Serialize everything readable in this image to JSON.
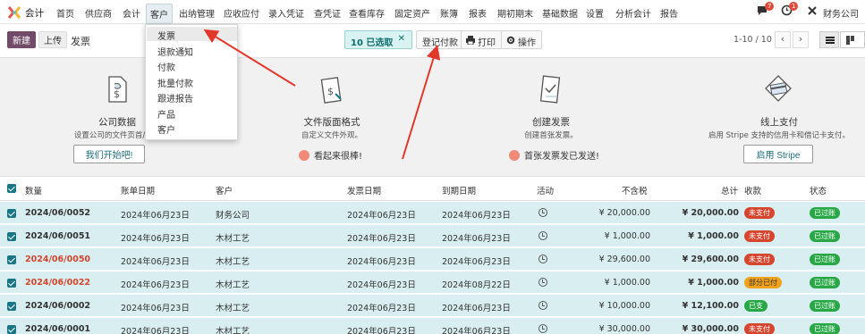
{
  "topnav": {
    "app_name": "会计",
    "items": [
      "首页",
      "供应商",
      "会计",
      "客户",
      "出纳管理",
      "应收应付",
      "录入凭证",
      "查凭证",
      "查看库存",
      "固定资产",
      "账簿",
      "报表",
      "期初期末",
      "基础数据",
      "设置",
      "分析会计",
      "报告"
    ],
    "chat_count": "7",
    "activity_count": "1",
    "company": "财务公司"
  },
  "dropdown": {
    "items": [
      "发票",
      "退款通知",
      "付款",
      "批量付款",
      "跟进报告",
      "产品",
      "客户"
    ]
  },
  "control": {
    "new_label": "新建",
    "upload_label": "上传",
    "title": "发票",
    "selected_label": "10 已选取",
    "register_payment_label": "登记付款",
    "print_label": "打印",
    "action_label": "操作",
    "pager": "1-10 / 10"
  },
  "onboarding": {
    "steps": [
      {
        "title": "公司数据",
        "desc": "设置公司的文件页首/页尾",
        "button": "我们开始吧!"
      },
      {
        "title": "文件版面格式",
        "desc": "自定义文件外观。",
        "done": "看起来很棒!"
      },
      {
        "title": "创建发票",
        "desc": "创建首张发票。",
        "done": "首张发票发已发送!"
      },
      {
        "title": "线上支付",
        "desc": "启用 Stripe 支持的信用卡和借记卡支付。",
        "button": "启用 Stripe"
      }
    ]
  },
  "table": {
    "headers": {
      "number": "数量",
      "bill_date": "账单日期",
      "customer": "客户",
      "invoice_date": "发票日期",
      "due_date": "到期日期",
      "activity": "活动",
      "untaxed": "不含税",
      "total": "总计",
      "payment": "收款",
      "status": "状态"
    },
    "rows": [
      {
        "number": "2024/06/0052",
        "bill_date": "2024年06月23日",
        "customer": "财务公司",
        "invoice_date": "2024年06月23日",
        "due_date": "2024年06月23日",
        "untaxed": "¥ 20,000.00",
        "total": "¥ 20,000.00",
        "payment": "未支付",
        "payment_kind": "red",
        "status": "已过账",
        "red_number": false
      },
      {
        "number": "2024/06/0051",
        "bill_date": "2024年06月23日",
        "customer": "木材工艺",
        "invoice_date": "2024年06月23日",
        "due_date": "2024年06月23日",
        "untaxed": "¥ 1,000.00",
        "total": "¥ 1,000.00",
        "payment": "未支付",
        "payment_kind": "red",
        "status": "已过账",
        "red_number": false
      },
      {
        "number": "2024/06/0050",
        "bill_date": "2024年06月23日",
        "customer": "木材工艺",
        "invoice_date": "2024年06月23日",
        "due_date": "2024年06月23日",
        "untaxed": "¥ 29,600.00",
        "total": "¥ 29,600.00",
        "payment": "未支付",
        "payment_kind": "red",
        "status": "已过账",
        "red_number": true
      },
      {
        "number": "2024/06/0022",
        "bill_date": "2024年06月23日",
        "customer": "木材工艺",
        "invoice_date": "2024年06月23日",
        "due_date": "2024年08月22日",
        "untaxed": "¥ 1,000.00",
        "total": "¥ 1,000.00",
        "payment": "部分已付",
        "payment_kind": "orange",
        "status": "已过账",
        "red_number": true
      },
      {
        "number": "2024/06/0002",
        "bill_date": "2024年06月23日",
        "customer": "木材工艺",
        "invoice_date": "2024年06月23日",
        "due_date": "2024年06月23日",
        "untaxed": "¥ 10,000.00",
        "total": "¥ 12,100.00",
        "payment": "已支",
        "payment_kind": "green",
        "status": "已过账",
        "red_number": false
      },
      {
        "number": "2024/06/0001",
        "bill_date": "2024年06月23日",
        "customer": "木材工艺",
        "invoice_date": "2024年06月23日",
        "due_date": "2024年06月23日",
        "untaxed": "¥ 30,000.00",
        "total": "¥ 30,000.00",
        "payment": "未支付",
        "payment_kind": "red",
        "status": "已过账",
        "red_number": false
      }
    ]
  },
  "colors": {
    "brand": "#714b67",
    "selected_row": "#d9eef0",
    "accent": "#1a7585"
  }
}
